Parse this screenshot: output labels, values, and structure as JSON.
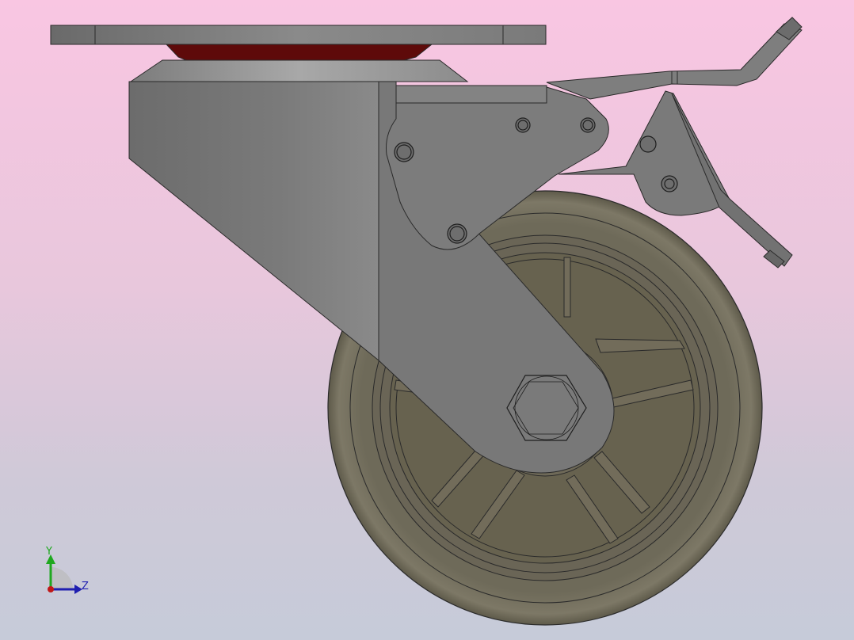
{
  "viewport": {
    "background_top": "#f9c6e2",
    "background_bottom": "#c6cbd9"
  },
  "model": {
    "part_color": "#7a7a7a",
    "wheel_color": "#6b6655",
    "swivel_color": "#5e0a0a",
    "edge_color": "#2a2a2a"
  },
  "triad": {
    "y_label": "Y",
    "z_label": "Z",
    "y_color": "#1fa81f",
    "z_color": "#1f1fb0",
    "x_color": "#c01818"
  }
}
